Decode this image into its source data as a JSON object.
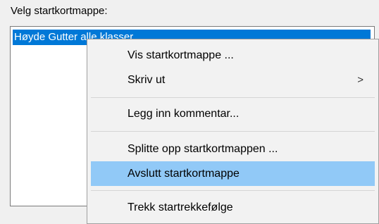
{
  "dialog": {
    "caption": "Velg startkortmappe:",
    "list_items": [
      "Høyde Gutter alle klasser"
    ]
  },
  "context_menu": {
    "items": [
      {
        "label": "Vis startkortmappe ..."
      },
      {
        "label": "Skriv ut",
        "submenu_arrow": ">"
      },
      {
        "label": "Legg inn kommentar..."
      },
      {
        "label": "Splitte opp startkortmappen ..."
      },
      {
        "label": "Avslutt startkortmappe",
        "highlighted": true
      },
      {
        "label": "Trekk startrekkefølge"
      }
    ],
    "highlight_color": "#91c9f7"
  },
  "colors": {
    "selection": "#0078d7",
    "menu_background": "#f2f2f2",
    "window_background": "#f0f0f0"
  }
}
